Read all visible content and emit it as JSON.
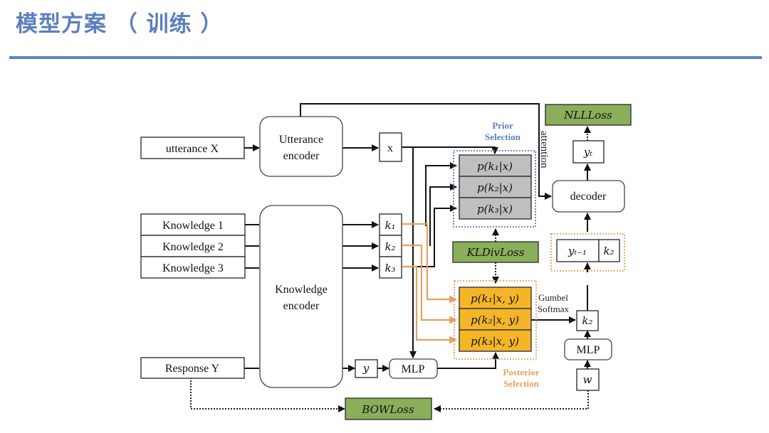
{
  "slide": {
    "title": "模型方案 （ 训练 ）",
    "accent_color": "#5b84c0"
  },
  "diagram": {
    "inputs": {
      "utterance": "utterance X",
      "knowledge": [
        "Knowledge 1",
        "Knowledge 2",
        "Knowledge 3"
      ],
      "response": "Response Y"
    },
    "encoders": {
      "utterance_encoder": [
        "Utterance",
        "encoder"
      ],
      "knowledge_encoder": [
        "Knowledge",
        "encoder"
      ]
    },
    "vectors": {
      "x": "x",
      "k": [
        "k₁",
        "k₂",
        "k₃"
      ],
      "y": "y",
      "w": "w",
      "k_selected": "k₂",
      "y_t": "yₜ",
      "y_prev": "yₜ₋₁",
      "k_concat": "k₂"
    },
    "mlp_label": "MLP",
    "decoder_label": "decoder",
    "prior": {
      "label_line1": "Prior",
      "label_line2": "Selection",
      "rows": [
        "p(k₁|x)",
        "p(k₂|x)",
        "p(k₃|x)"
      ],
      "color": "#bfbfbf"
    },
    "posterior": {
      "label_line1": "Posterior",
      "label_line2": "Selection",
      "rows": [
        "p(k₁|x, y)",
        "p(k₂|x, y)",
        "p(k₃|x, y)"
      ],
      "color": "#f4b627"
    },
    "losses": {
      "nll": "NLLLoss",
      "kl": "KLDivLoss",
      "bow": "BOWLoss",
      "color": "#8bae5a"
    },
    "annotations": {
      "attention": "attention",
      "gumbel_line1": "Gumbel",
      "gumbel_line2": "Softmax"
    }
  }
}
